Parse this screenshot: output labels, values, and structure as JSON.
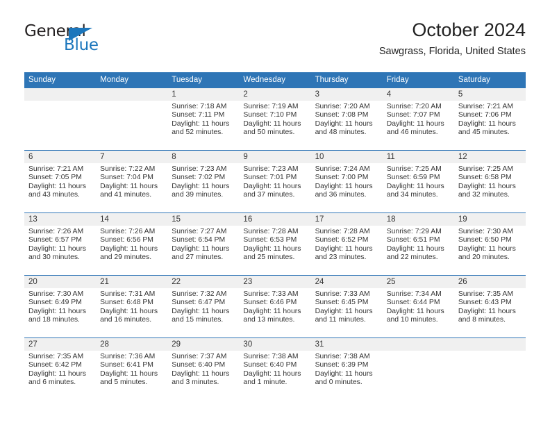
{
  "brand": {
    "name_top": "General",
    "name_bottom": "Blue",
    "colors": {
      "blue": "#1b76bc",
      "dark": "#231f20"
    }
  },
  "header": {
    "title": "October 2024",
    "subtitle": "Sawgrass, Florida, United States"
  },
  "theme": {
    "header_blue": "#2e75b6",
    "daynum_gray": "#f0f0f0",
    "text": "#333333"
  },
  "weekday_headers": [
    "Sunday",
    "Monday",
    "Tuesday",
    "Wednesday",
    "Thursday",
    "Friday",
    "Saturday"
  ],
  "labels": {
    "sunrise": "Sunrise:",
    "sunset": "Sunset:",
    "daylight": "Daylight:"
  },
  "weeks": [
    [
      {
        "day": "",
        "sunrise": "",
        "sunset": "",
        "daylight1": "",
        "daylight2": ""
      },
      {
        "day": "",
        "sunrise": "",
        "sunset": "",
        "daylight1": "",
        "daylight2": ""
      },
      {
        "day": "1",
        "sunrise": "Sunrise: 7:18 AM",
        "sunset": "Sunset: 7:11 PM",
        "daylight1": "Daylight: 11 hours",
        "daylight2": "and 52 minutes."
      },
      {
        "day": "2",
        "sunrise": "Sunrise: 7:19 AM",
        "sunset": "Sunset: 7:10 PM",
        "daylight1": "Daylight: 11 hours",
        "daylight2": "and 50 minutes."
      },
      {
        "day": "3",
        "sunrise": "Sunrise: 7:20 AM",
        "sunset": "Sunset: 7:08 PM",
        "daylight1": "Daylight: 11 hours",
        "daylight2": "and 48 minutes."
      },
      {
        "day": "4",
        "sunrise": "Sunrise: 7:20 AM",
        "sunset": "Sunset: 7:07 PM",
        "daylight1": "Daylight: 11 hours",
        "daylight2": "and 46 minutes."
      },
      {
        "day": "5",
        "sunrise": "Sunrise: 7:21 AM",
        "sunset": "Sunset: 7:06 PM",
        "daylight1": "Daylight: 11 hours",
        "daylight2": "and 45 minutes."
      }
    ],
    [
      {
        "day": "6",
        "sunrise": "Sunrise: 7:21 AM",
        "sunset": "Sunset: 7:05 PM",
        "daylight1": "Daylight: 11 hours",
        "daylight2": "and 43 minutes."
      },
      {
        "day": "7",
        "sunrise": "Sunrise: 7:22 AM",
        "sunset": "Sunset: 7:04 PM",
        "daylight1": "Daylight: 11 hours",
        "daylight2": "and 41 minutes."
      },
      {
        "day": "8",
        "sunrise": "Sunrise: 7:23 AM",
        "sunset": "Sunset: 7:02 PM",
        "daylight1": "Daylight: 11 hours",
        "daylight2": "and 39 minutes."
      },
      {
        "day": "9",
        "sunrise": "Sunrise: 7:23 AM",
        "sunset": "Sunset: 7:01 PM",
        "daylight1": "Daylight: 11 hours",
        "daylight2": "and 37 minutes."
      },
      {
        "day": "10",
        "sunrise": "Sunrise: 7:24 AM",
        "sunset": "Sunset: 7:00 PM",
        "daylight1": "Daylight: 11 hours",
        "daylight2": "and 36 minutes."
      },
      {
        "day": "11",
        "sunrise": "Sunrise: 7:25 AM",
        "sunset": "Sunset: 6:59 PM",
        "daylight1": "Daylight: 11 hours",
        "daylight2": "and 34 minutes."
      },
      {
        "day": "12",
        "sunrise": "Sunrise: 7:25 AM",
        "sunset": "Sunset: 6:58 PM",
        "daylight1": "Daylight: 11 hours",
        "daylight2": "and 32 minutes."
      }
    ],
    [
      {
        "day": "13",
        "sunrise": "Sunrise: 7:26 AM",
        "sunset": "Sunset: 6:57 PM",
        "daylight1": "Daylight: 11 hours",
        "daylight2": "and 30 minutes."
      },
      {
        "day": "14",
        "sunrise": "Sunrise: 7:26 AM",
        "sunset": "Sunset: 6:56 PM",
        "daylight1": "Daylight: 11 hours",
        "daylight2": "and 29 minutes."
      },
      {
        "day": "15",
        "sunrise": "Sunrise: 7:27 AM",
        "sunset": "Sunset: 6:54 PM",
        "daylight1": "Daylight: 11 hours",
        "daylight2": "and 27 minutes."
      },
      {
        "day": "16",
        "sunrise": "Sunrise: 7:28 AM",
        "sunset": "Sunset: 6:53 PM",
        "daylight1": "Daylight: 11 hours",
        "daylight2": "and 25 minutes."
      },
      {
        "day": "17",
        "sunrise": "Sunrise: 7:28 AM",
        "sunset": "Sunset: 6:52 PM",
        "daylight1": "Daylight: 11 hours",
        "daylight2": "and 23 minutes."
      },
      {
        "day": "18",
        "sunrise": "Sunrise: 7:29 AM",
        "sunset": "Sunset: 6:51 PM",
        "daylight1": "Daylight: 11 hours",
        "daylight2": "and 22 minutes."
      },
      {
        "day": "19",
        "sunrise": "Sunrise: 7:30 AM",
        "sunset": "Sunset: 6:50 PM",
        "daylight1": "Daylight: 11 hours",
        "daylight2": "and 20 minutes."
      }
    ],
    [
      {
        "day": "20",
        "sunrise": "Sunrise: 7:30 AM",
        "sunset": "Sunset: 6:49 PM",
        "daylight1": "Daylight: 11 hours",
        "daylight2": "and 18 minutes."
      },
      {
        "day": "21",
        "sunrise": "Sunrise: 7:31 AM",
        "sunset": "Sunset: 6:48 PM",
        "daylight1": "Daylight: 11 hours",
        "daylight2": "and 16 minutes."
      },
      {
        "day": "22",
        "sunrise": "Sunrise: 7:32 AM",
        "sunset": "Sunset: 6:47 PM",
        "daylight1": "Daylight: 11 hours",
        "daylight2": "and 15 minutes."
      },
      {
        "day": "23",
        "sunrise": "Sunrise: 7:33 AM",
        "sunset": "Sunset: 6:46 PM",
        "daylight1": "Daylight: 11 hours",
        "daylight2": "and 13 minutes."
      },
      {
        "day": "24",
        "sunrise": "Sunrise: 7:33 AM",
        "sunset": "Sunset: 6:45 PM",
        "daylight1": "Daylight: 11 hours",
        "daylight2": "and 11 minutes."
      },
      {
        "day": "25",
        "sunrise": "Sunrise: 7:34 AM",
        "sunset": "Sunset: 6:44 PM",
        "daylight1": "Daylight: 11 hours",
        "daylight2": "and 10 minutes."
      },
      {
        "day": "26",
        "sunrise": "Sunrise: 7:35 AM",
        "sunset": "Sunset: 6:43 PM",
        "daylight1": "Daylight: 11 hours",
        "daylight2": "and 8 minutes."
      }
    ],
    [
      {
        "day": "27",
        "sunrise": "Sunrise: 7:35 AM",
        "sunset": "Sunset: 6:42 PM",
        "daylight1": "Daylight: 11 hours",
        "daylight2": "and 6 minutes."
      },
      {
        "day": "28",
        "sunrise": "Sunrise: 7:36 AM",
        "sunset": "Sunset: 6:41 PM",
        "daylight1": "Daylight: 11 hours",
        "daylight2": "and 5 minutes."
      },
      {
        "day": "29",
        "sunrise": "Sunrise: 7:37 AM",
        "sunset": "Sunset: 6:40 PM",
        "daylight1": "Daylight: 11 hours",
        "daylight2": "and 3 minutes."
      },
      {
        "day": "30",
        "sunrise": "Sunrise: 7:38 AM",
        "sunset": "Sunset: 6:40 PM",
        "daylight1": "Daylight: 11 hours",
        "daylight2": "and 1 minute."
      },
      {
        "day": "31",
        "sunrise": "Sunrise: 7:38 AM",
        "sunset": "Sunset: 6:39 PM",
        "daylight1": "Daylight: 11 hours",
        "daylight2": "and 0 minutes."
      },
      {
        "day": "",
        "sunrise": "",
        "sunset": "",
        "daylight1": "",
        "daylight2": ""
      },
      {
        "day": "",
        "sunrise": "",
        "sunset": "",
        "daylight1": "",
        "daylight2": ""
      }
    ]
  ]
}
